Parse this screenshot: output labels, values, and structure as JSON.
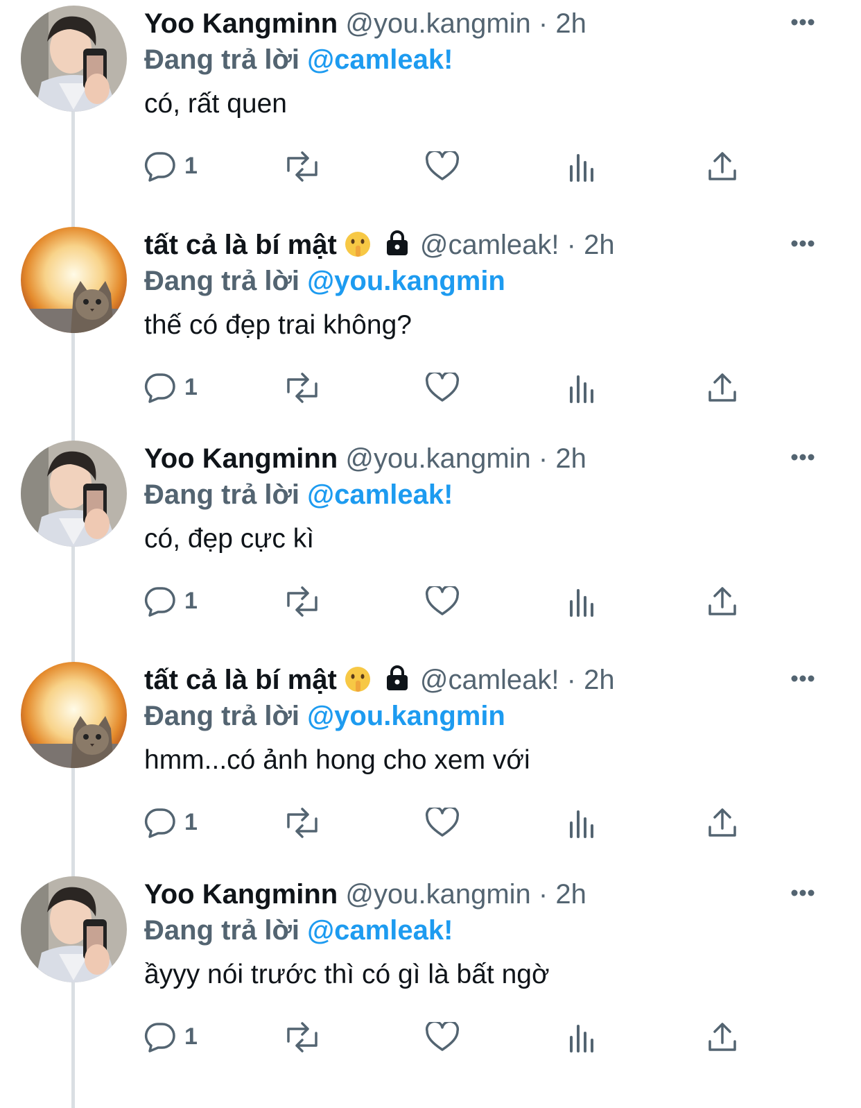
{
  "colors": {
    "text": "#0f1419",
    "secondary": "#536471",
    "link": "#1d9bf0",
    "thread_line": "#dadfe3"
  },
  "tweets": [
    {
      "author": "yoo",
      "name": "Yoo Kangminn",
      "handle": "@you.kangmin",
      "separator": "·",
      "time": "2h",
      "replying_prefix": "Đang trả lời",
      "replying_to": "@camleak!",
      "text": "có, rất quen",
      "reply_count": "1"
    },
    {
      "author": "cam",
      "name": "tất cả là bí mật",
      "name_emoji_icon": "shushing-face-emoji",
      "locked": true,
      "handle": "@camleak!",
      "separator": "·",
      "time": "2h",
      "replying_prefix": "Đang trả lời",
      "replying_to": "@you.kangmin",
      "text": "thế có đẹp trai không?",
      "reply_count": "1"
    },
    {
      "author": "yoo",
      "name": "Yoo Kangminn",
      "handle": "@you.kangmin",
      "separator": "·",
      "time": "2h",
      "replying_prefix": "Đang trả lời",
      "replying_to": "@camleak!",
      "text": "có, đẹp cực kì",
      "reply_count": "1"
    },
    {
      "author": "cam",
      "name": "tất cả là bí mật",
      "name_emoji_icon": "shushing-face-emoji",
      "locked": true,
      "handle": "@camleak!",
      "separator": "·",
      "time": "2h",
      "replying_prefix": "Đang trả lời",
      "replying_to": "@you.kangmin",
      "text": "hmm...có ảnh hong cho xem với",
      "reply_count": "1"
    },
    {
      "author": "yoo",
      "name": "Yoo Kangminn",
      "handle": "@you.kangmin",
      "separator": "·",
      "time": "2h",
      "replying_prefix": "Đang trả lời",
      "replying_to": "@camleak!",
      "text": "ầyyy nói trước thì có gì là bất ngờ",
      "reply_count": "1"
    }
  ]
}
